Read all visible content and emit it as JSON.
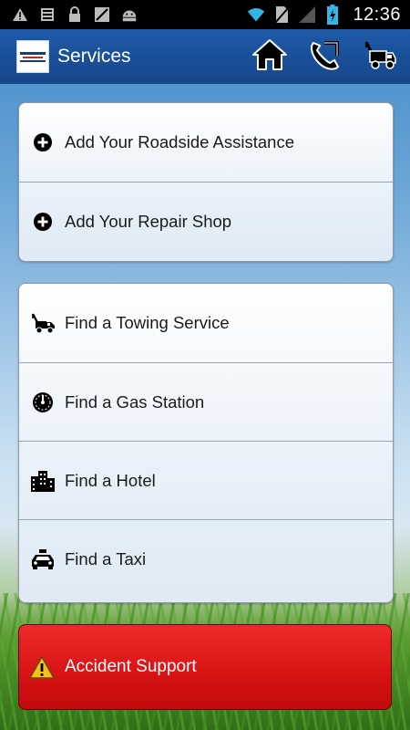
{
  "status_bar": {
    "time": "12:36",
    "icons": [
      "warning-icon",
      "sd-card-icon",
      "lock-icon",
      "no-image-icon",
      "android-icon",
      "wifi-icon",
      "no-sim-icon",
      "signal-icon",
      "battery-charging-icon"
    ]
  },
  "action_bar": {
    "title": "Services",
    "logo": "company-logo",
    "buttons": [
      "home-icon",
      "phone-icon",
      "tow-truck-icon"
    ]
  },
  "groups": [
    {
      "items": [
        {
          "label": "Add Your Roadside Assistance",
          "icon": "plus-circle-icon"
        },
        {
          "label": "Add Your Repair Shop",
          "icon": "plus-circle-icon"
        }
      ]
    },
    {
      "items": [
        {
          "label": "Find a Towing Service",
          "icon": "tow-truck-icon"
        },
        {
          "label": "Find a Gas Station",
          "icon": "gauge-icon"
        },
        {
          "label": "Find a Hotel",
          "icon": "hotel-icon"
        },
        {
          "label": "Find a Taxi",
          "icon": "taxi-icon"
        }
      ]
    }
  ],
  "accident": {
    "label": "Accident Support",
    "icon": "warning-icon"
  },
  "colors": {
    "action_bar": "#1a4f9a",
    "accident": "#d91414"
  }
}
